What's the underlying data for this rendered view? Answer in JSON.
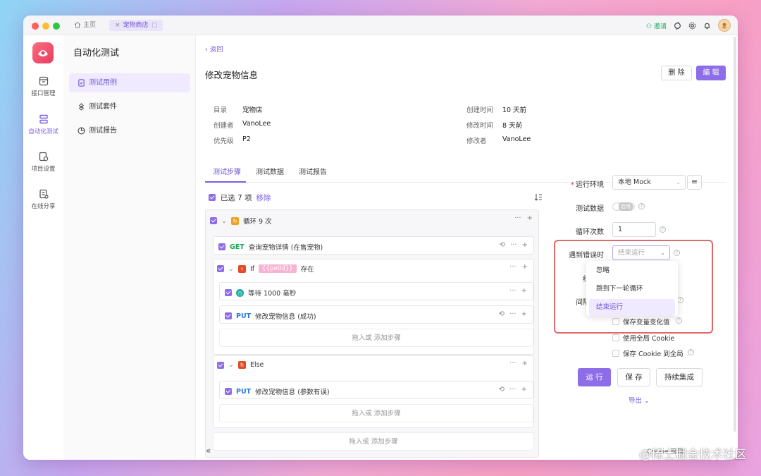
{
  "window": {
    "tabs": {
      "home": "主页",
      "shop": "宠物商店"
    },
    "invite": "邀请"
  },
  "nav": {
    "items": [
      "接口管理",
      "自动化测试",
      "项目设置",
      "在线分享"
    ],
    "active": "自动化测试"
  },
  "sub": {
    "title": "自动化测试",
    "items": [
      "测试用例",
      "测试套件",
      "测试报告"
    ]
  },
  "page": {
    "back": "返回",
    "title": "修改宠物信息",
    "delete": "删 除",
    "edit": "编 辑",
    "meta": [
      {
        "label": "目录",
        "value": "宠物店"
      },
      {
        "label": "创建者",
        "value": "VanoLee"
      },
      {
        "label": "优先级",
        "value": "P2"
      },
      {
        "label": "创建时间",
        "value": "10 天前"
      },
      {
        "label": "修改时间",
        "value": "8 天前"
      },
      {
        "label": "修改者",
        "value": "VanoLee"
      }
    ],
    "tabs": [
      "测试步骤",
      "测试数据",
      "测试报告"
    ]
  },
  "steps": {
    "selected": "已选 7 项",
    "remove": "移除",
    "loop": "循环 9 次",
    "get_method": "GET",
    "get_name": "查询宠物详情 (在售宠物)",
    "if_label": "If",
    "if_var": "{{petId}}",
    "if_cond": "存在",
    "wait": "等待 1000 毫秒",
    "put_method": "PUT",
    "put1": "修改宠物信息 (成功)",
    "drop": "拖入或 添加步骤",
    "else": "Else",
    "put2": "修改宠物信息 (参数有误)"
  },
  "settings": {
    "env_label": "运行环境",
    "env_value": "本地 Mock",
    "data_label": "测试数据",
    "data_toggle": "启用",
    "loop_label": "循环次数",
    "loop_value": "1",
    "error_label": "遇到错误时",
    "error_placeholder": "结束运行",
    "threads_label": "线程数",
    "interval_label": "间隔停顿",
    "options": [
      "忽略",
      "跳到下一轮循环",
      "结束运行"
    ],
    "chk1": "保存变量变化值",
    "chk2": "使用全局 Cookie",
    "chk3": "保存 Cookie 到全局",
    "run": "运 行",
    "save": "保 存",
    "ci": "持续集成",
    "export": "导出"
  },
  "footer": {
    "cookie": "Cookie 管理"
  },
  "watermark": "@稀土掘金技术社区",
  "colors": {
    "accent": "#8e6de8",
    "highlight": "#e06a6a"
  }
}
